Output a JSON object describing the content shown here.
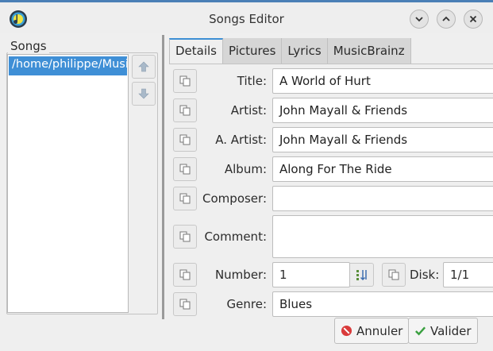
{
  "window": {
    "title": "Songs Editor",
    "accent_color": "#3f8fd6"
  },
  "songs": {
    "label": "Songs",
    "items": [
      "/home/philippe/Musi"
    ]
  },
  "tabs": [
    {
      "label": "Details",
      "active": true
    },
    {
      "label": "Pictures",
      "active": false
    },
    {
      "label": "Lyrics",
      "active": false
    },
    {
      "label": "MusicBrainz",
      "active": false
    }
  ],
  "form": {
    "title": {
      "label": "Title:",
      "value": "A World of Hurt"
    },
    "artist": {
      "label": "Artist:",
      "value": "John Mayall & Friends"
    },
    "album_artist": {
      "label": "A. Artist:",
      "value": "John Mayall & Friends"
    },
    "album": {
      "label": "Album:",
      "value": "Along For The Ride"
    },
    "composer": {
      "label": "Composer:",
      "value": ""
    },
    "comment": {
      "label": "Comment:",
      "value": ""
    },
    "number": {
      "label": "Number:",
      "value": "1"
    },
    "disk": {
      "label": "Disk:",
      "value": "1/1"
    },
    "genre": {
      "label": "Genre:",
      "value": "Blues"
    }
  },
  "buttons": {
    "cancel": "Annuler",
    "validate": "Valider"
  }
}
